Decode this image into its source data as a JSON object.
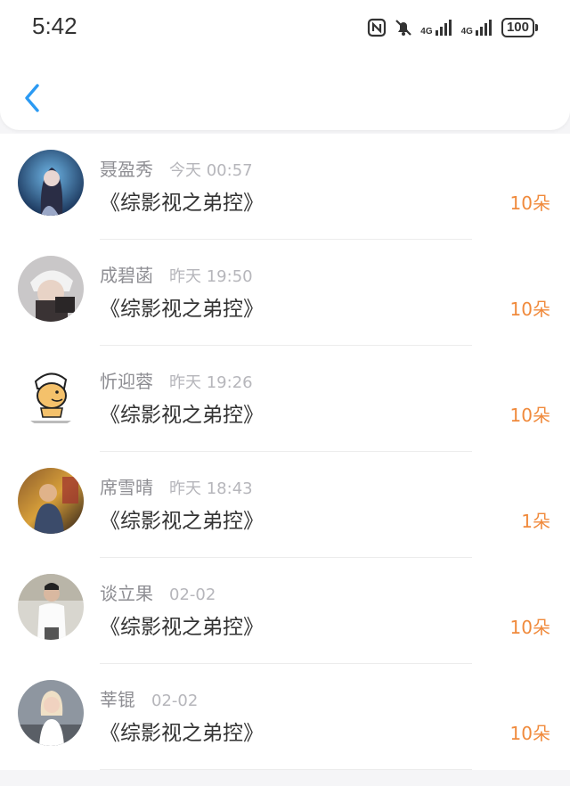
{
  "status_bar": {
    "time": "5:42",
    "net1": "4G",
    "net2": "4G",
    "battery": "100"
  },
  "nav": {
    "back_icon": "chevron-left-icon",
    "accent": "#2b9af3"
  },
  "colors": {
    "amount": "#f08a3c",
    "name": "#8e8e93",
    "time": "#b6b6bb"
  },
  "items": [
    {
      "name": "聂盈秀",
      "time": "今天 00:57",
      "title": "《综影视之弟控》",
      "amount": "10朵"
    },
    {
      "name": "成碧菡",
      "time": "昨天 19:50",
      "title": "《综影视之弟控》",
      "amount": "10朵"
    },
    {
      "name": "忻迎蓉",
      "time": "昨天 19:26",
      "title": "《综影视之弟控》",
      "amount": "10朵"
    },
    {
      "name": "席雪晴",
      "time": "昨天 18:43",
      "title": "《综影视之弟控》",
      "amount": "1朵"
    },
    {
      "name": "谈立果",
      "time": "02-02",
      "title": "《综影视之弟控》",
      "amount": "10朵"
    },
    {
      "name": "莘锟",
      "time": "02-02",
      "title": "《综影视之弟控》",
      "amount": "10朵"
    }
  ]
}
